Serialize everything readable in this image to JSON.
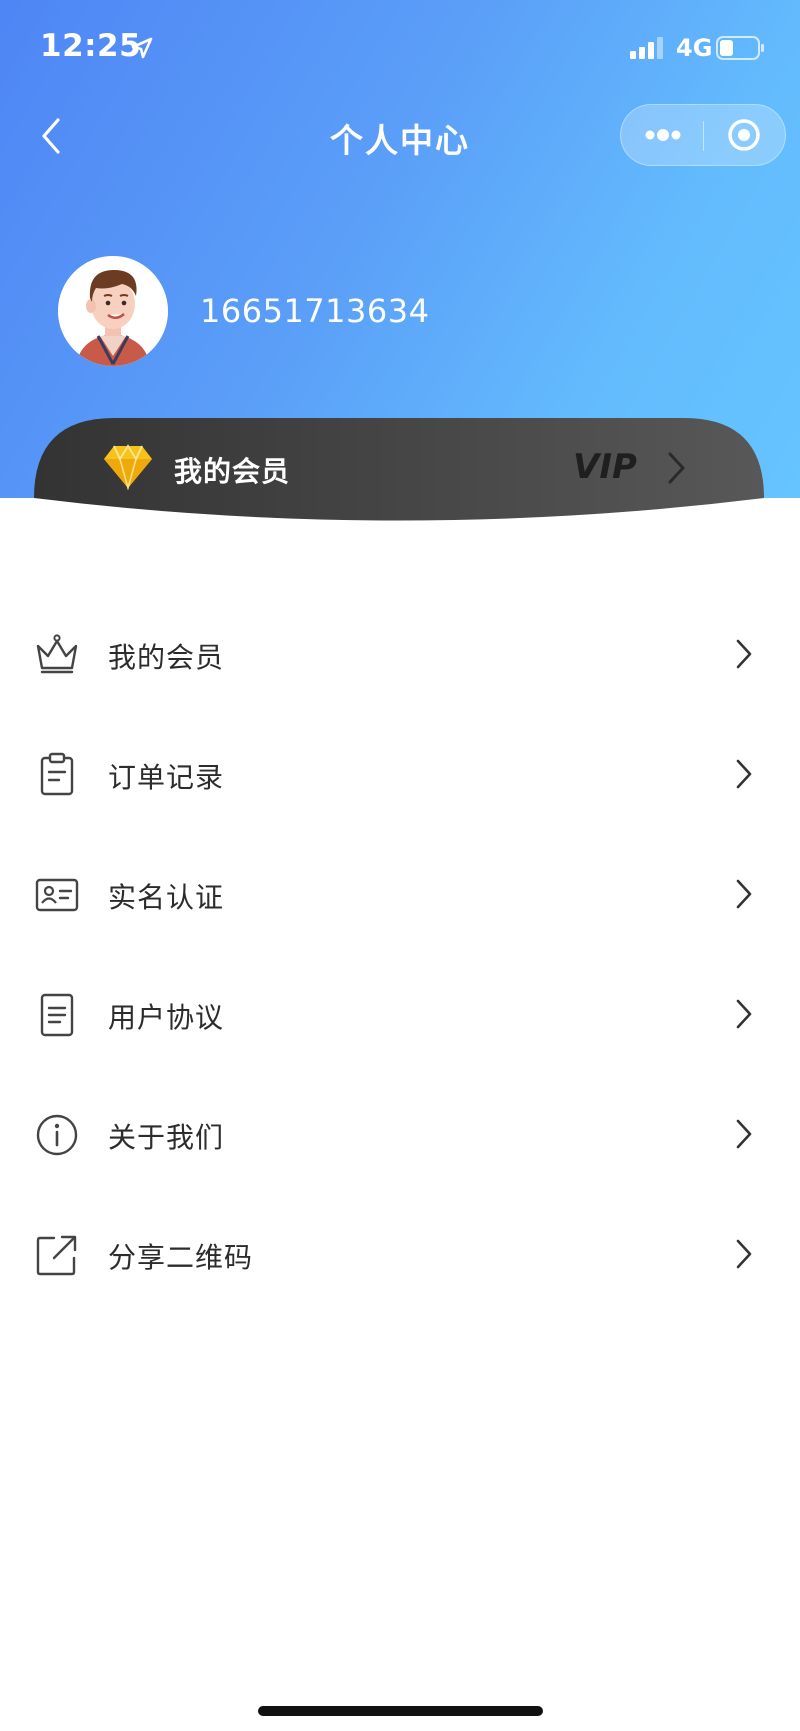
{
  "status_bar": {
    "time": "12:25",
    "network": "4G"
  },
  "nav": {
    "title": "个人中心"
  },
  "profile": {
    "phone": "16651713634"
  },
  "vip_card": {
    "label": "我的会员",
    "badge": "VIP"
  },
  "menu": [
    {
      "label": "我的会员",
      "icon": "crown-icon"
    },
    {
      "label": "订单记录",
      "icon": "clipboard-icon"
    },
    {
      "label": "实名认证",
      "icon": "id-card-icon"
    },
    {
      "label": "用户协议",
      "icon": "document-icon"
    },
    {
      "label": "关于我们",
      "icon": "info-icon"
    },
    {
      "label": "分享二维码",
      "icon": "share-icon"
    }
  ],
  "colors": {
    "header_gradient_start": "#4e86f5",
    "header_gradient_end": "#66c4ff",
    "vip_card": "#3c3c3c",
    "diamond": "#f5c518"
  }
}
